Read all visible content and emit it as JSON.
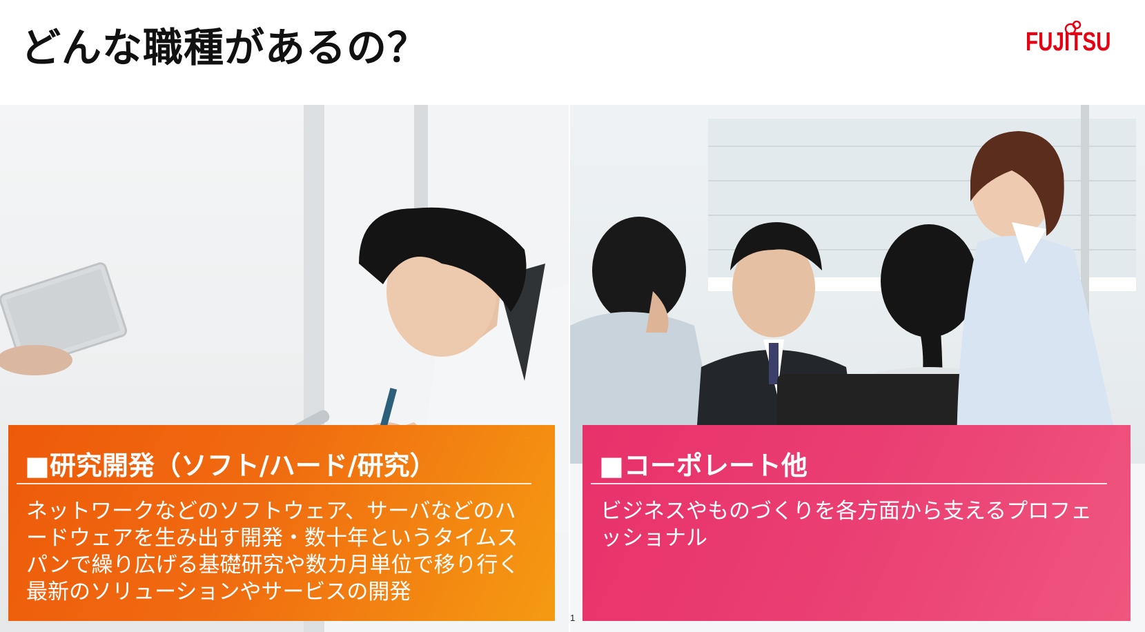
{
  "slide": {
    "title": "どんな職種があるの？",
    "page_number": "1"
  },
  "logo": {
    "text": "FUJITSU",
    "color": "#e60012"
  },
  "panels": [
    {
      "heading": "■研究開発（ソフト/ハード/研究）",
      "body": "ネットワークなどのソフトウェア、サーバなどのハードウェアを生み出す開発・数十年というタイムスパンで繰り広げる基礎研究や数カ月単位で移り行く最新のソリューションやサービスの開発",
      "color": "#ef6410"
    },
    {
      "heading": "■コーポレート他",
      "body": "ビジネスやものづくりを各方面から支えるプロフェッショナル",
      "color": "#e8316a"
    }
  ]
}
